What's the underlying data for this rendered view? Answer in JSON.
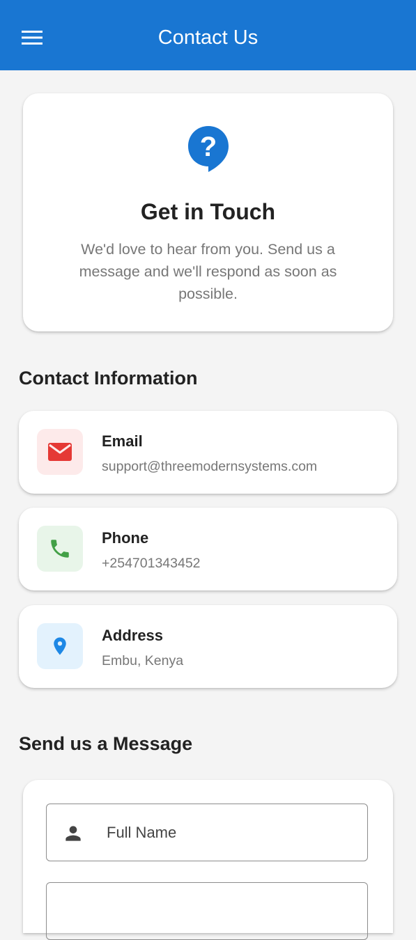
{
  "appbar": {
    "title": "Contact Us",
    "bg_color": "#1976d2",
    "menu_icon": "hamburger-menu-icon"
  },
  "hero": {
    "icon": "help-bubble-icon",
    "icon_color": "#1976d2",
    "title": "Get in Touch",
    "description": "We'd love to hear from you. Send us a message and we'll respond as soon as possible."
  },
  "contact_section": {
    "title": "Contact Information",
    "items": [
      {
        "label": "Email",
        "value": "support@threemodernsystems.com",
        "icon": "mail-icon",
        "icon_color": "#e53935",
        "icon_bg": "#fdeaea"
      },
      {
        "label": "Phone",
        "value": "+254701343452",
        "icon": "phone-icon",
        "icon_color": "#43a047",
        "icon_bg": "#e8f5e9"
      },
      {
        "label": "Address",
        "value": "Embu, Kenya",
        "icon": "location-pin-icon",
        "icon_color": "#1e88e5",
        "icon_bg": "#e3f2fd"
      }
    ]
  },
  "message_section": {
    "title": "Send us a Message",
    "fields": [
      {
        "placeholder": "Full Name",
        "icon": "person-icon"
      }
    ]
  }
}
